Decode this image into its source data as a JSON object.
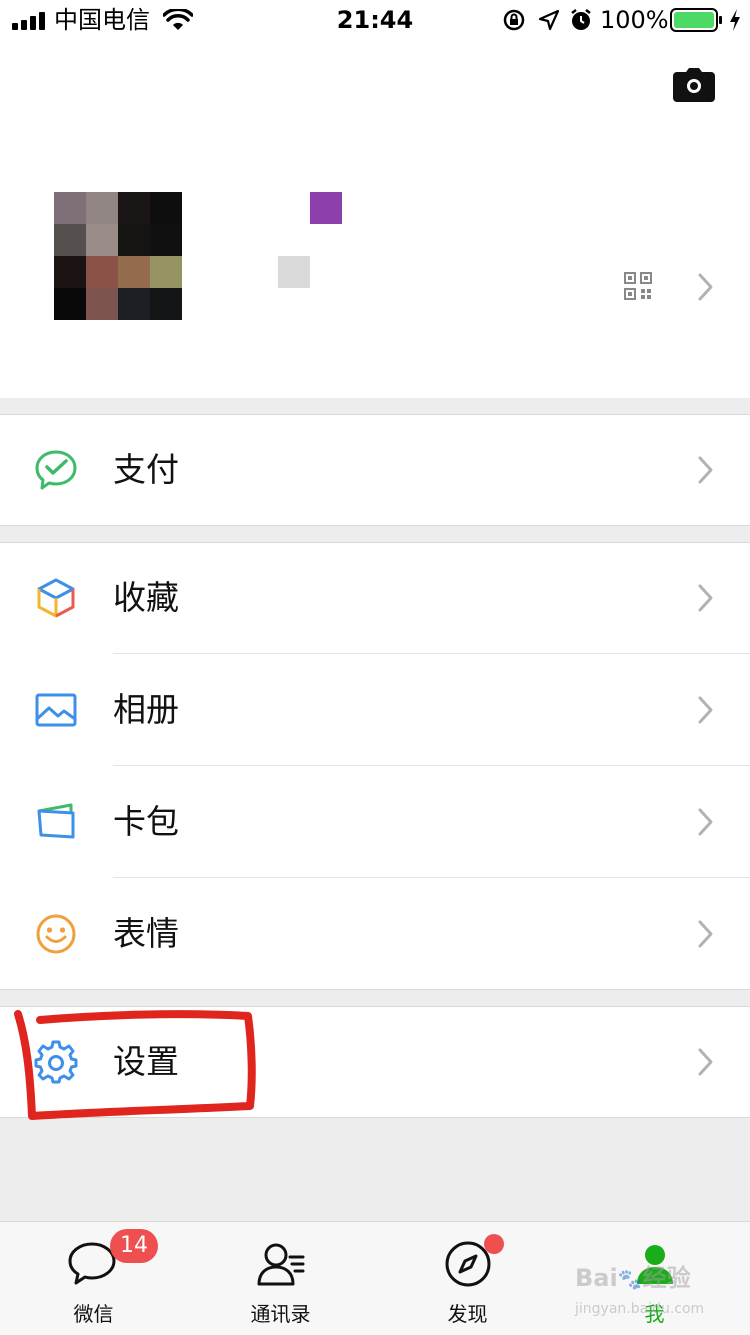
{
  "status_bar": {
    "carrier": "中国电信",
    "time": "21:44",
    "battery": "100%"
  },
  "profile": {
    "camera_icon": "camera-icon",
    "qr_icon": "qr-code-icon"
  },
  "menu": {
    "pay": "支付",
    "favorites": "收藏",
    "album": "相册",
    "cards": "卡包",
    "stickers": "表情",
    "settings": "设置"
  },
  "tabs": [
    {
      "label": "微信",
      "badge": "14"
    },
    {
      "label": "通讯录"
    },
    {
      "label": "发现"
    },
    {
      "label": "我"
    }
  ],
  "colors": {
    "accent_green": "#1aad19",
    "badge_red": "#f04f4f",
    "highlight_red": "#e0241e"
  },
  "watermark": "Baidu 经验 jingyan.baidu.com"
}
